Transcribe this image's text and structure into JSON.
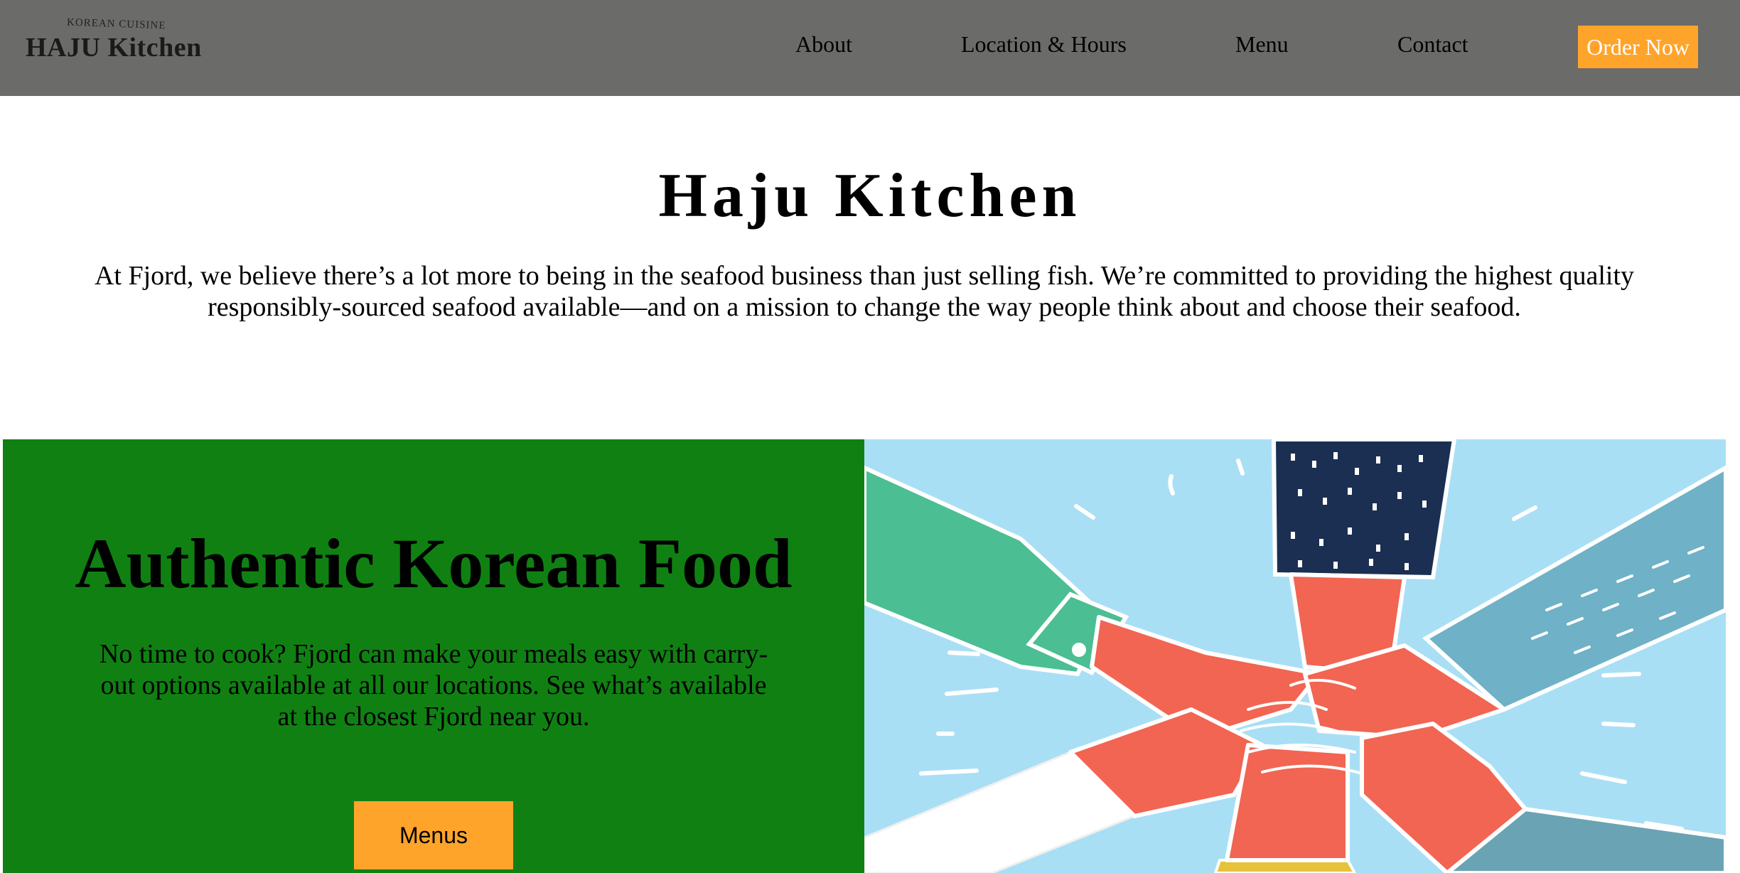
{
  "header": {
    "logo": {
      "tagline": "KOREAN CUISINE",
      "name": "HAJU Kitchen"
    },
    "nav": [
      {
        "label": "About"
      },
      {
        "label": "Location & Hours"
      },
      {
        "label": "Menu"
      },
      {
        "label": "Contact"
      }
    ],
    "cta_label": "Order Now",
    "colors": {
      "bar": "#6b6b69",
      "cta": "#ffa42a"
    }
  },
  "hero": {
    "title": "Haju Kitchen",
    "text": "At Fjord, we believe there’s a lot more to being in the seafood business than just selling fish. We’re committed to providing the highest quality responsibly-sourced seafood available—and on a mission to change the way people think about and choose their seafood."
  },
  "feature": {
    "title": "Authentic Korean Food",
    "text": "No time to cook? Fjord can make your meals easy with carry-out options available at all our locations. See what’s available at the closest Fjord near you.",
    "button_label": "Menus",
    "panel_color": "#108013",
    "image_icon": "stacked-hands-illustration"
  }
}
